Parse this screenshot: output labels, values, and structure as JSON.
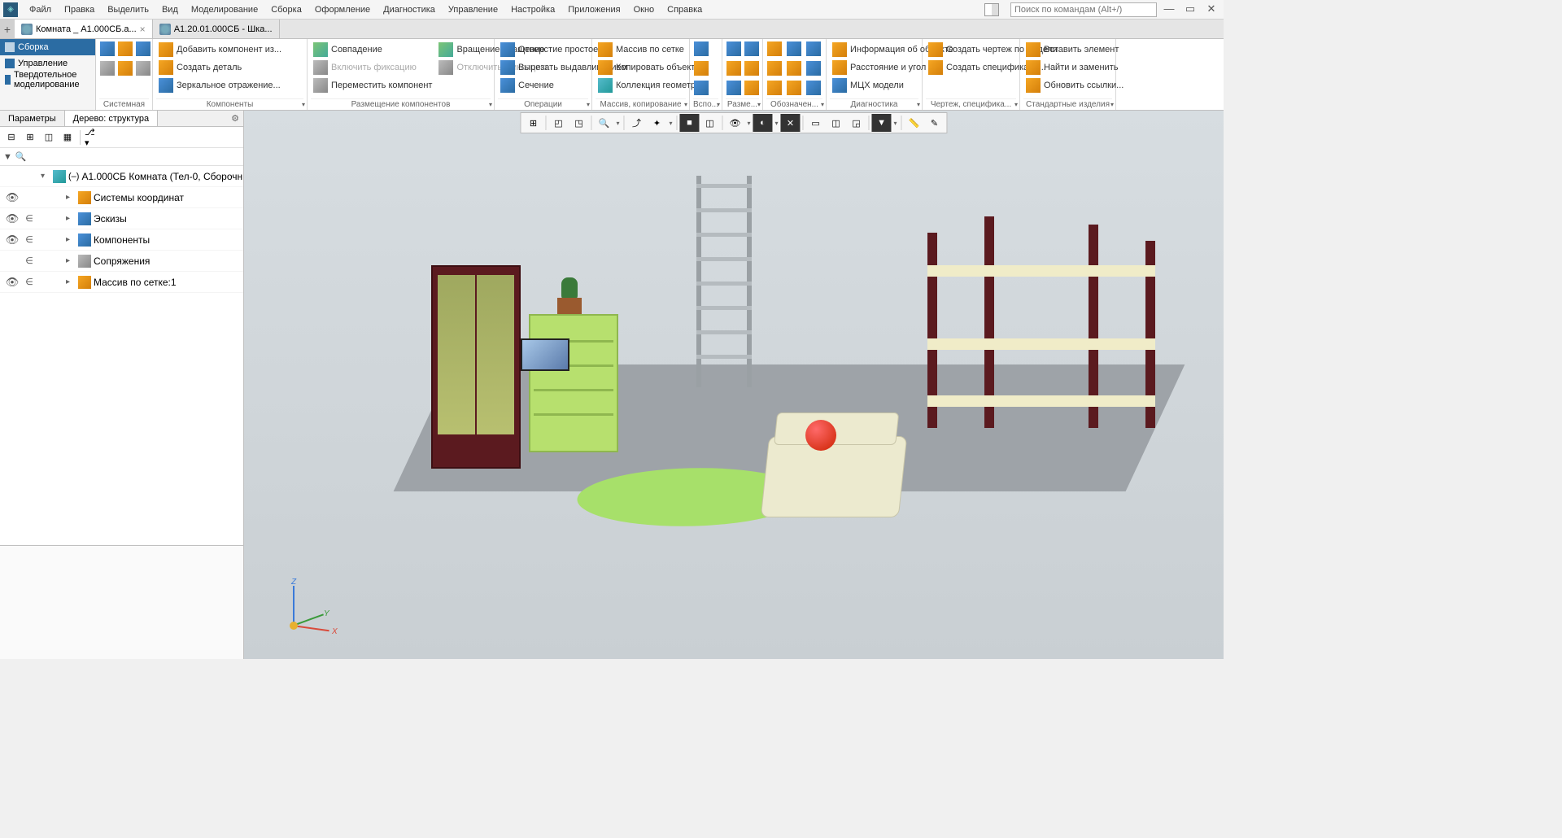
{
  "menu": [
    "Файл",
    "Правка",
    "Выделить",
    "Вид",
    "Моделирование",
    "Сборка",
    "Оформление",
    "Диагностика",
    "Управление",
    "Настройка",
    "Приложения",
    "Окно",
    "Справка"
  ],
  "search_placeholder": "Поиск по командам (Alt+/)",
  "tabs": [
    {
      "label": "Комната _ А1.000СБ.а...",
      "active": true
    },
    {
      "label": "А1.20.01.000СБ - Шка...",
      "active": false
    }
  ],
  "ribbon_tabs": [
    {
      "label": "Сборка",
      "active": true
    },
    {
      "label": "Управление",
      "active": false
    },
    {
      "label": "Твердотельное моделирование",
      "active": false
    }
  ],
  "ribbon_groups": {
    "g1": {
      "label": "Системная"
    },
    "g2": {
      "label": "Компоненты",
      "btns": [
        {
          "l": "Добавить компонент из..."
        },
        {
          "l": "Создать деталь"
        },
        {
          "l": "Зеркальное отражение..."
        }
      ]
    },
    "g3": {
      "label": "Размещение компонентов",
      "btns": [
        {
          "l": "Совпадение"
        },
        {
          "l": "Включить фиксацию",
          "dim": true
        },
        {
          "l": "Переместить компонент"
        },
        {
          "l": "Вращение-вращение"
        },
        {
          "l": "Отключить фиксацию",
          "dim": true
        }
      ]
    },
    "g4": {
      "label": "Операции",
      "btns": [
        {
          "l": "Отверстие простое"
        },
        {
          "l": "Вырезать выдавливанием"
        },
        {
          "l": "Сечение"
        }
      ]
    },
    "g5": {
      "label": "Массив, копирование",
      "btns": [
        {
          "l": "Массив по сетке"
        },
        {
          "l": "Копировать объекты"
        },
        {
          "l": "Коллекция геометрии"
        }
      ]
    },
    "g6": {
      "label": "Вспо..."
    },
    "g7": {
      "label": "Разме..."
    },
    "g8": {
      "label": "Обозначен..."
    },
    "g9": {
      "label": "Диагностика",
      "btns": [
        {
          "l": "Информация об объекте"
        },
        {
          "l": "Расстояние и угол"
        },
        {
          "l": "МЦХ модели"
        }
      ]
    },
    "g10": {
      "label": "Чертеж, специфика...",
      "btns": [
        {
          "l": "Создать чертеж по модели"
        },
        {
          "l": "Создать спецификаци..."
        }
      ]
    },
    "g11": {
      "label": "Стандартные изделия",
      "btns": [
        {
          "l": "Вставить элемент"
        },
        {
          "l": "Найти и заменить"
        },
        {
          "l": "Обновить ссылки..."
        }
      ]
    }
  },
  "panel_tabs": {
    "params": "Параметры",
    "tree": "Дерево: структура"
  },
  "tree_root": "А1.000СБ Комната (Тел-0, Сборочн",
  "tree_nodes": [
    {
      "label": "Системы координат",
      "vis": true,
      "inc": false
    },
    {
      "label": "Эскизы",
      "vis": true,
      "inc": true
    },
    {
      "label": "Компоненты",
      "vis": true,
      "inc": true
    },
    {
      "label": "Сопряжения",
      "vis": false,
      "inc": true
    },
    {
      "label": "Массив по сетке:1",
      "vis": true,
      "inc": true
    }
  ],
  "axis": {
    "x": "X",
    "y": "Y",
    "z": "Z"
  }
}
